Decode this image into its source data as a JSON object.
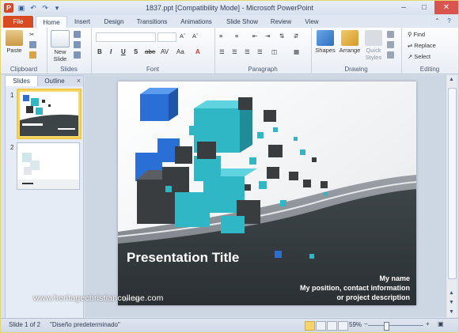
{
  "window": {
    "title": "1837.ppt [Compatibility Mode] - Microsoft PowerPoint",
    "app_icon": "P"
  },
  "tabs": [
    {
      "label": "File"
    },
    {
      "label": "Home"
    },
    {
      "label": "Insert"
    },
    {
      "label": "Design"
    },
    {
      "label": "Transitions"
    },
    {
      "label": "Animations"
    },
    {
      "label": "Slide Show"
    },
    {
      "label": "Review"
    },
    {
      "label": "View"
    }
  ],
  "ribbon": {
    "clipboard": {
      "label": "Clipboard",
      "paste": "Paste"
    },
    "slides": {
      "label": "Slides",
      "new_slide": "New Slide"
    },
    "font": {
      "label": "Font",
      "bold": "B",
      "italic": "I",
      "underline": "U",
      "strike": "S",
      "shadow": "abe",
      "spacing": "AV",
      "case": "Aa",
      "color": "A"
    },
    "paragraph": {
      "label": "Paragraph"
    },
    "drawing": {
      "label": "Drawing",
      "shapes": "Shapes",
      "arrange": "Arrange",
      "quick_styles": "Quick Styles"
    },
    "editing": {
      "label": "Editing",
      "find": "Find",
      "replace": "Replace",
      "select": "Select"
    }
  },
  "left_panel": {
    "tabs": [
      "Slides",
      "Outline"
    ],
    "slides": [
      {
        "number": "1"
      },
      {
        "number": "2"
      }
    ]
  },
  "slide": {
    "title": "Presentation Title",
    "line1": "My name",
    "line2": "My position, contact information",
    "line3": "or project description",
    "footer": "fppt.com"
  },
  "watermark": "www.heritagechristiancollege.com",
  "status": {
    "slide_info": "Slide 1 of 2",
    "theme": "\"Diseño predeterminado\"",
    "zoom": "59%"
  },
  "colors": {
    "file_tab": "#d84b22",
    "selection": "#f3c844",
    "cube_teal": "#2fb7c6",
    "cube_blue": "#2a6fd6"
  }
}
